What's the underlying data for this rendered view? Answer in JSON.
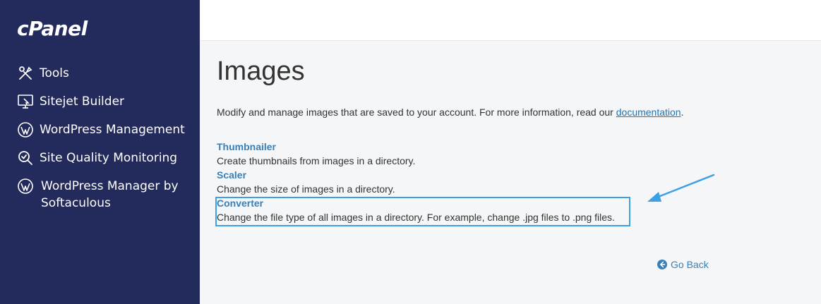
{
  "sidebar": {
    "logo": "cPanel",
    "items": [
      {
        "label": "Tools",
        "icon": "tools-icon"
      },
      {
        "label": "Sitejet Builder",
        "icon": "monitor-icon"
      },
      {
        "label": "WordPress Management",
        "icon": "wordpress-icon"
      },
      {
        "label": "Site Quality Monitoring",
        "icon": "magnifier-check-icon"
      },
      {
        "label": "WordPress Manager by",
        "label2": "Softaculous",
        "icon": "wordpress-icon"
      }
    ]
  },
  "main": {
    "title": "Images",
    "intro_text": "Modify and manage images that are saved to your account. For more information, read our ",
    "intro_link": "documentation",
    "intro_end": ".",
    "tools": [
      {
        "name": "Thumbnailer",
        "desc": "Create thumbnails from images in a directory."
      },
      {
        "name": "Scaler",
        "desc": "Change the size of images in a directory."
      },
      {
        "name": "Converter",
        "desc": "Change the file type of all images in a directory. For example, change .jpg files to .png files."
      }
    ],
    "go_back": "Go Back"
  },
  "colors": {
    "sidebar_bg": "#222b5b",
    "link": "#3a7fb6",
    "highlight": "#3aa0e8"
  }
}
